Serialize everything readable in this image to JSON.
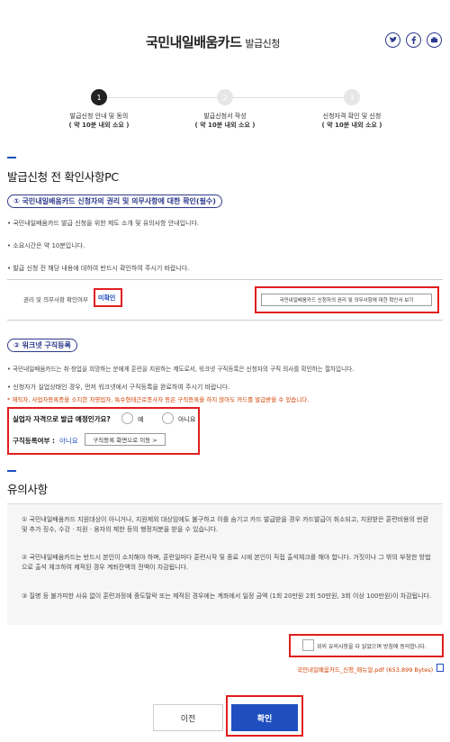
{
  "header": {
    "title": "국민내일배움카드",
    "subtitle": "발급신청",
    "share_icons": [
      "twitter-icon",
      "facebook-icon",
      "share-icon"
    ]
  },
  "steps": [
    {
      "number": "1",
      "label": "발급신청 안내 및 동의",
      "time": "( 약 10분 내외 소요 )",
      "active": true
    },
    {
      "number": "2",
      "label": "발급신청서 작성",
      "time": "( 약 10분 내외 소요 )",
      "active": false
    },
    {
      "number": "3",
      "label": "신청자격 확인 및 신청",
      "time": "( 약 10분 내외 소요 )",
      "active": false
    }
  ],
  "section1": {
    "heading": "발급신청 전 확인사항PC",
    "pill": "① 국민내일배움카드 신청자의 권리 및 의무사항에 대한 확인(필수)",
    "bullets": [
      "• 국민내일배움카드 발급 신청을 위한 제도 소개 및 유의사항 안내입니다.",
      "• 소요시간은 약 10분입니다.",
      "• 발급 신청 전 해당 내용에 대하여 반드시 확인하여 주시기 바랍니다."
    ],
    "confirm_label": "권리 및 의무사항 확인여부",
    "confirm_status": "미확인",
    "view_button": "국민내일배움카드 신청자의 권리 및 의무사항에 대한 확인서 보기"
  },
  "section2": {
    "pill": "② 워크넷 구직등록",
    "bullets": [
      "• 국민내일배움카드는 취·창업을 희망하는 분에게 훈련을 지원하는 제도로서, 워크넷 구직등록은 신청자의 구직 의사를 확인하는 절차입니다.",
      "• 신청자가 실업상태인 경우, 먼저 워크넷에서 구직등록을 완료하여 주시기 바랍니다."
    ],
    "warning": "* 재직자, 사업자등록증을 소지한 자영업자, 특수형태근로종사자 등은 구직등록을 하지 않아도 카드를 발급받을 수 있습니다.",
    "question": "실업자 자격으로 발급 예정인가요?",
    "yes_label": "예",
    "no_label": "아니요",
    "reg_label": "구직등록여부 :",
    "reg_status": "아니요",
    "reg_button": "구직등록 화면으로 이동 >"
  },
  "section3": {
    "heading": "유의사항",
    "items": [
      "① 국민내일배움카드 지원대상이 아니거나, 지원제외 대상임에도 불구하고 이를 숨기고 카드 발급받을 경우 카드발급이 취소되고, 지원받은 훈련비용의 반환 및 추가 징수, 수강 · 지원 · 융자의 제한 등의 행정처분을 받을 수 있습니다.",
      "② 국민내일배움카드는 반드시 본인이 소지해야 하며, 훈련일마다 훈련시작 및 종료 시에 본인이 직접 출석체크를 해야 합니다. 거짓이나 그 밖의 부정한 방법으로 출석 체크하여 제적된 경우 계좌잔액의 전액이 차감됩니다.",
      "③ 질병 등 불가피한 사유 없이 훈련과정에 중도탈락 또는 제적된 경우에는 계좌에서 일정 금액 (1회 20만원 2회 50만원, 3회 이상 100만원)이 차감됩니다."
    ],
    "agree_label": "위의 유의사항을 다 읽었으며 방침에 동의합니다.",
    "pdf_link": "국민내일배움카드_신청_매뉴얼.pdf",
    "pdf_size": "(653,899 Bytes)"
  },
  "footer": {
    "prev_label": "이전",
    "confirm_label": "확인"
  },
  "colors": {
    "accent": "#1f4fbf",
    "highlight": "#e01e1e",
    "navy": "#2d3a8c"
  }
}
